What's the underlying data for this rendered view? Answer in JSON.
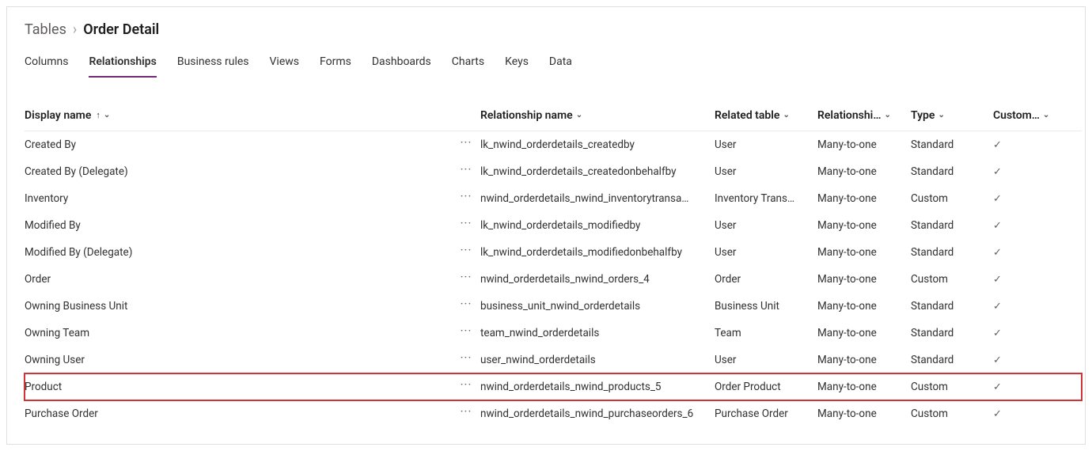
{
  "breadcrumb": {
    "parent": "Tables",
    "sep": "›",
    "current": "Order Detail"
  },
  "tabs": [
    {
      "label": "Columns"
    },
    {
      "label": "Relationships",
      "active": true
    },
    {
      "label": "Business rules"
    },
    {
      "label": "Views"
    },
    {
      "label": "Forms"
    },
    {
      "label": "Dashboards"
    },
    {
      "label": "Charts"
    },
    {
      "label": "Keys"
    },
    {
      "label": "Data"
    }
  ],
  "columns": {
    "display_name": "Display name",
    "relationship_name": "Relationship name",
    "related_table": "Related table",
    "relationship_type": "Relationshi…",
    "type": "Type",
    "customizable": "Custom…"
  },
  "rows": [
    {
      "display": "Created By",
      "rel": "lk_nwind_orderdetails_createdby",
      "related": "User",
      "ship": "Many-to-one",
      "type": "Standard",
      "custom": true
    },
    {
      "display": "Created By (Delegate)",
      "rel": "lk_nwind_orderdetails_createdonbehalfby",
      "related": "User",
      "ship": "Many-to-one",
      "type": "Standard",
      "custom": true
    },
    {
      "display": "Inventory",
      "rel": "nwind_orderdetails_nwind_inventorytransa…",
      "related": "Inventory Trans…",
      "ship": "Many-to-one",
      "type": "Custom",
      "custom": true
    },
    {
      "display": "Modified By",
      "rel": "lk_nwind_orderdetails_modifiedby",
      "related": "User",
      "ship": "Many-to-one",
      "type": "Standard",
      "custom": true
    },
    {
      "display": "Modified By (Delegate)",
      "rel": "lk_nwind_orderdetails_modifiedonbehalfby",
      "related": "User",
      "ship": "Many-to-one",
      "type": "Standard",
      "custom": true
    },
    {
      "display": "Order",
      "rel": "nwind_orderdetails_nwind_orders_4",
      "related": "Order",
      "ship": "Many-to-one",
      "type": "Custom",
      "custom": true
    },
    {
      "display": "Owning Business Unit",
      "rel": "business_unit_nwind_orderdetails",
      "related": "Business Unit",
      "ship": "Many-to-one",
      "type": "Standard",
      "custom": true
    },
    {
      "display": "Owning Team",
      "rel": "team_nwind_orderdetails",
      "related": "Team",
      "ship": "Many-to-one",
      "type": "Standard",
      "custom": true
    },
    {
      "display": "Owning User",
      "rel": "user_nwind_orderdetails",
      "related": "User",
      "ship": "Many-to-one",
      "type": "Standard",
      "custom": true
    },
    {
      "display": "Product",
      "rel": "nwind_orderdetails_nwind_products_5",
      "related": "Order Product",
      "ship": "Many-to-one",
      "type": "Custom",
      "custom": true,
      "highlight": true
    },
    {
      "display": "Purchase Order",
      "rel": "nwind_orderdetails_nwind_purchaseorders_6",
      "related": "Purchase Order",
      "ship": "Many-to-one",
      "type": "Custom",
      "custom": true
    }
  ]
}
